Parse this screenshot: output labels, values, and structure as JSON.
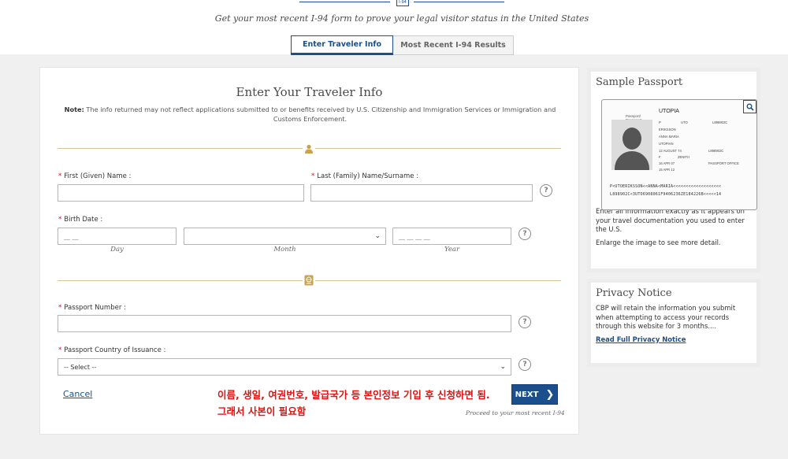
{
  "header": {
    "badge": "I-94",
    "tagline": "Get your most recent I-94 form to prove your legal visitor status in the United States"
  },
  "tabs": [
    {
      "label": "Enter Traveler Info",
      "active": true
    },
    {
      "label": "Most Recent I-94 Results",
      "active": false
    }
  ],
  "form": {
    "title": "Enter Your Traveler Info",
    "note_label": "Note:",
    "note_text": " The info returned may not reflect applications submitted to or benefits received by U.S. Citizenship and Immigration Services or Immigration and Customs Enforcement.",
    "required_mark": "*",
    "first_name_label": "First (Given) Name :",
    "first_name_value": "",
    "last_name_label": "Last (Family) Name/Surname :",
    "last_name_value": "",
    "birth_date_label": "Birth Date :",
    "day_placeholder": "__ __",
    "day_caption": "Day",
    "month_value": "",
    "month_caption": "Month",
    "year_placeholder": "__ __ __ __",
    "year_caption": "Year",
    "passport_number_label": "Passport Number :",
    "passport_number_value": "",
    "country_label": "Passport Country of Issuance :",
    "country_selected": "-- Select --",
    "help_glyph": "?",
    "cancel_label": "Cancel",
    "next_label": "NEXT",
    "proceed_caption": "Proceed to your most recent I-94"
  },
  "annotation": {
    "line1": "이름, 생일, 여권번호, 발급국가 등 본인정보 기입 후 신청하면 됨.",
    "line2": "그래서 사본이 필요함"
  },
  "sidebar": {
    "sample_title": "Sample Passport",
    "sample_text": "Enter all information exactly as it appears on your travel documentation you used to enter the U.S.",
    "sample_hint": "Enlarge the image to see more detail.",
    "privacy_title": "Privacy Notice",
    "privacy_text": "CBP will retain the information you submit when attempting to access your records through this website for 3 months....",
    "privacy_link": "Read Full Privacy Notice"
  },
  "passport_sample": {
    "country": "UTOPIA",
    "label_line1": "Passport/",
    "label_line2": "Passeport",
    "type": "P",
    "code": "UTO",
    "number": "L898902C",
    "surname": "ERIKSSON",
    "given": "ANNA MARIA",
    "nationality": "UTOPIAN",
    "dob": "12 AUGUST 74",
    "sex": "F",
    "place": "ZENITH",
    "issued": "16 APR 07",
    "authority": "PASSPORT OFFICE",
    "expiry": "15 APR 12",
    "mrz1": "P<UTOERIKSSON<<ANNA<MARIA<<<<<<<<<<<<<<<<<<<",
    "mrz2": "L898902C<3UTO6908061F9406236ZE184226B<<<<<14"
  },
  "colors": {
    "brand_blue": "#1a4f8b",
    "gold": "#c9a24e",
    "required_red": "#c8102e",
    "annotation_red": "#e0130e"
  }
}
